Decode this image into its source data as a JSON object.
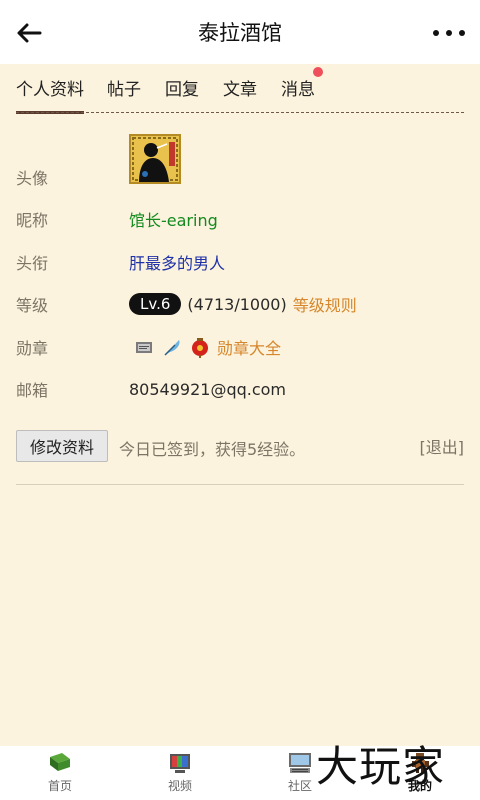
{
  "header": {
    "title": "泰拉酒馆",
    "back_icon": "back-arrow-icon",
    "more_icon": "more-dots-icon"
  },
  "tabs": [
    {
      "label": "个人资料",
      "active": true
    },
    {
      "label": "帖子",
      "active": false
    },
    {
      "label": "回复",
      "active": false
    },
    {
      "label": "文章",
      "active": false
    },
    {
      "label": "消息",
      "active": false,
      "badge_dot": true
    }
  ],
  "profile": {
    "avatar_label": "头像",
    "nickname_label": "昵称",
    "nickname": "馆长-earing",
    "title_label": "头衔",
    "title": "肝最多的男人",
    "level_label": "等级",
    "level_badge": "Lv.6",
    "level_progress": "(4713/1000)",
    "level_rules_link": "等级规则",
    "medal_label": "勋章",
    "medal_link": "勋章大全",
    "email_label": "邮箱",
    "email": "80549921@qq.com"
  },
  "actions": {
    "edit_button": "修改资料",
    "checkin_text": "今日已签到，获得5经验。",
    "logout_link": "[退出]"
  },
  "bottom_nav": [
    {
      "label": "首页",
      "icon": "book-icon",
      "active": false
    },
    {
      "label": "视频",
      "icon": "tv-icon",
      "active": false
    },
    {
      "label": "社区",
      "icon": "computer-icon",
      "active": false
    },
    {
      "label": "我的",
      "icon": "character-icon",
      "active": true
    }
  ],
  "watermark": "大玩家",
  "colors": {
    "background": "#fbf3dd",
    "nickname": "#138a1f",
    "title": "#1f31a8",
    "link": "#d6862b",
    "tab_underline": "#5a3b2c",
    "badge_dot": "#ef4f5a"
  }
}
